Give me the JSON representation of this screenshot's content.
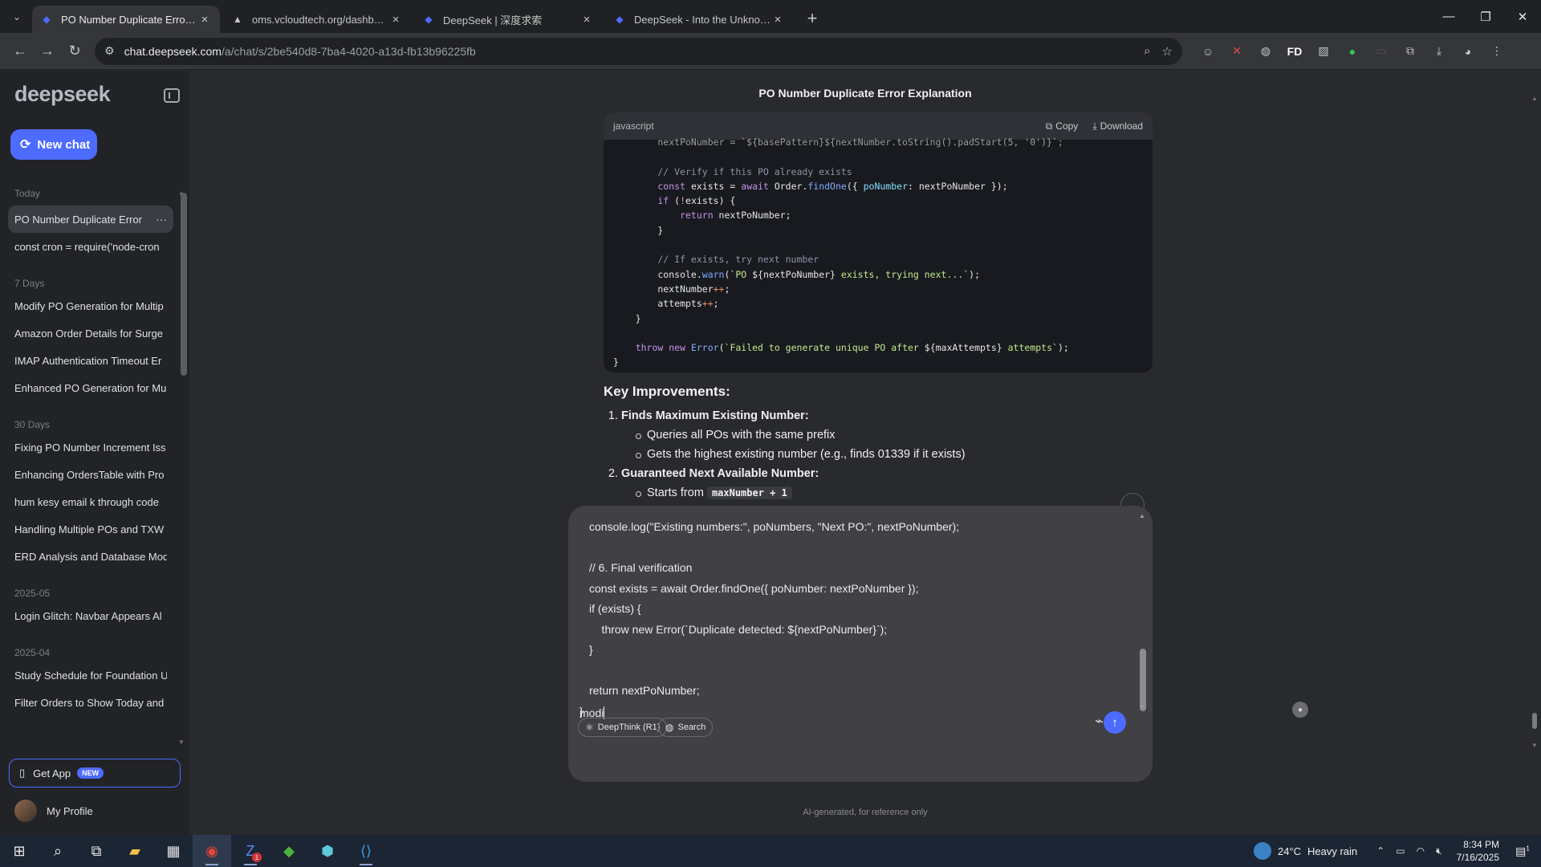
{
  "browser": {
    "tabs": [
      {
        "title": "PO Number Duplicate Error Exp",
        "favicon": "deepseek-icon",
        "active": true
      },
      {
        "title": "oms.vcloudtech.org/dashboard",
        "favicon": "triangle-icon",
        "active": false
      },
      {
        "title": "DeepSeek | 深度求索",
        "favicon": "deepseek-icon",
        "active": false
      },
      {
        "title": "DeepSeek - Into the Unknown",
        "favicon": "deepseek-icon",
        "active": false
      }
    ],
    "url_host": "chat.deepseek.com",
    "url_path": "/a/chat/s/2be540d8-7ba4-4020-a13d-fb13b96225fb"
  },
  "sidebar": {
    "logo": "deepseek",
    "new_chat_label": "New chat",
    "groups": [
      {
        "label": "Today",
        "items": [
          "PO Number Duplicate Error",
          "const cron = require('node-cron"
        ]
      },
      {
        "label": "7 Days",
        "items": [
          "Modify PO Generation for Multip",
          "Amazon Order Details for Surge",
          "IMAP Authentication Timeout Er",
          "Enhanced PO Generation for Mu"
        ]
      },
      {
        "label": "30 Days",
        "items": [
          "Fixing PO Number Increment Iss",
          "Enhancing OrdersTable with Pro",
          "hum kesy email k through code",
          "Handling Multiple POs and TXW",
          "ERD Analysis and Database Mod"
        ]
      },
      {
        "label": "2025-05",
        "items": [
          "Login Glitch: Navbar Appears Al"
        ]
      },
      {
        "label": "2025-04",
        "items": [
          "Study Schedule for Foundation U",
          "Filter Orders to Show Today and"
        ]
      }
    ],
    "get_app_label": "Get App",
    "get_app_badge": "NEW",
    "profile_label": "My Profile"
  },
  "chat": {
    "title": "PO Number Duplicate Error Explanation",
    "code_lang": "javascript",
    "copy_label": "Copy",
    "download_label": "Download",
    "key_heading": "Key Improvements:",
    "item1_title": "Finds Maximum Existing Number:",
    "item1_sub1": "Queries all POs with the same prefix",
    "item1_sub2": "Gets the highest existing number (e.g., finds 01339 if it exists)",
    "item2_title": "Guaranteed Next Available Number:",
    "item2_sub1_prefix": "Starts from",
    "item2_sub1_code": "maxNumber + 1"
  },
  "composer": {
    "text": "console.log(\"Existing numbers:\", poNumbers, \"Next PO:\", nextPoNumber);\n\n// 6. Final verification\nconst exists = await Order.findOne({ poNumber: nextPoNumber });\nif (exists) {\n    throw new Error(`Duplicate detected: ${nextPoNumber}`);\n}\n\nreturn nextPoNumber;",
    "closing_brace": "}",
    "typed": "modi",
    "deepthink_label": "DeepThink (R1)",
    "search_label": "Search",
    "disclaimer": "AI-generated, for reference only"
  },
  "taskbar": {
    "weather_temp": "24°C",
    "weather_desc": "Heavy rain",
    "time": "8:34 PM",
    "date": "7/16/2025",
    "zoom_badge": "1",
    "notif_count": "1"
  },
  "colors": {
    "accent": "#4d6bfe",
    "page_bg": "#292a2d",
    "sidebar_bg": "#212327",
    "composer_bg": "#404045"
  }
}
